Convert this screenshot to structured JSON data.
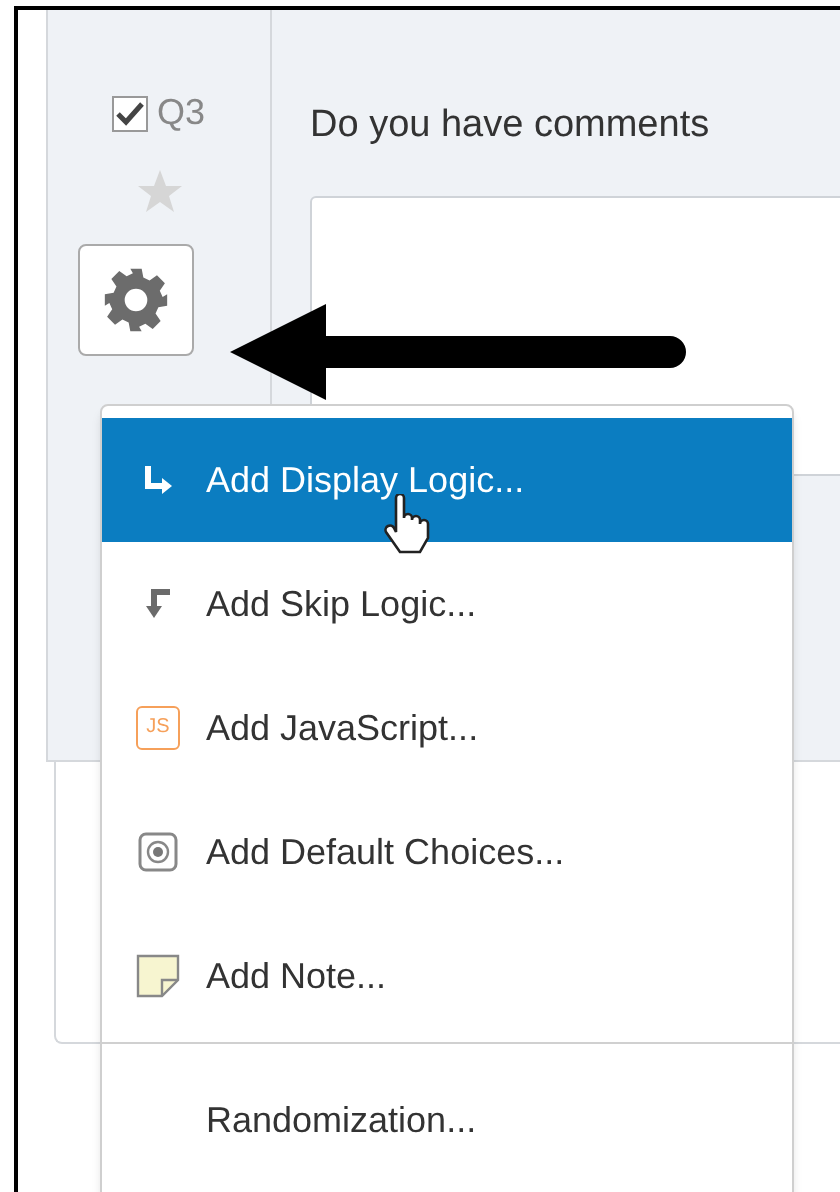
{
  "question": {
    "number": "Q3",
    "checked": true,
    "text": "Do you have comments"
  },
  "menu": {
    "items": [
      {
        "kind": "display",
        "label": "Add Display Logic...",
        "selected": true
      },
      {
        "kind": "skip",
        "label": "Add Skip Logic...",
        "selected": false
      },
      {
        "kind": "js",
        "label": "Add JavaScript...",
        "selected": false,
        "icon_text": "JS"
      },
      {
        "kind": "default",
        "label": "Add Default Choices...",
        "selected": false
      },
      {
        "kind": "note",
        "label": "Add Note...",
        "selected": false
      },
      {
        "kind": "plain",
        "label": "Randomization...",
        "selected": false
      }
    ]
  }
}
